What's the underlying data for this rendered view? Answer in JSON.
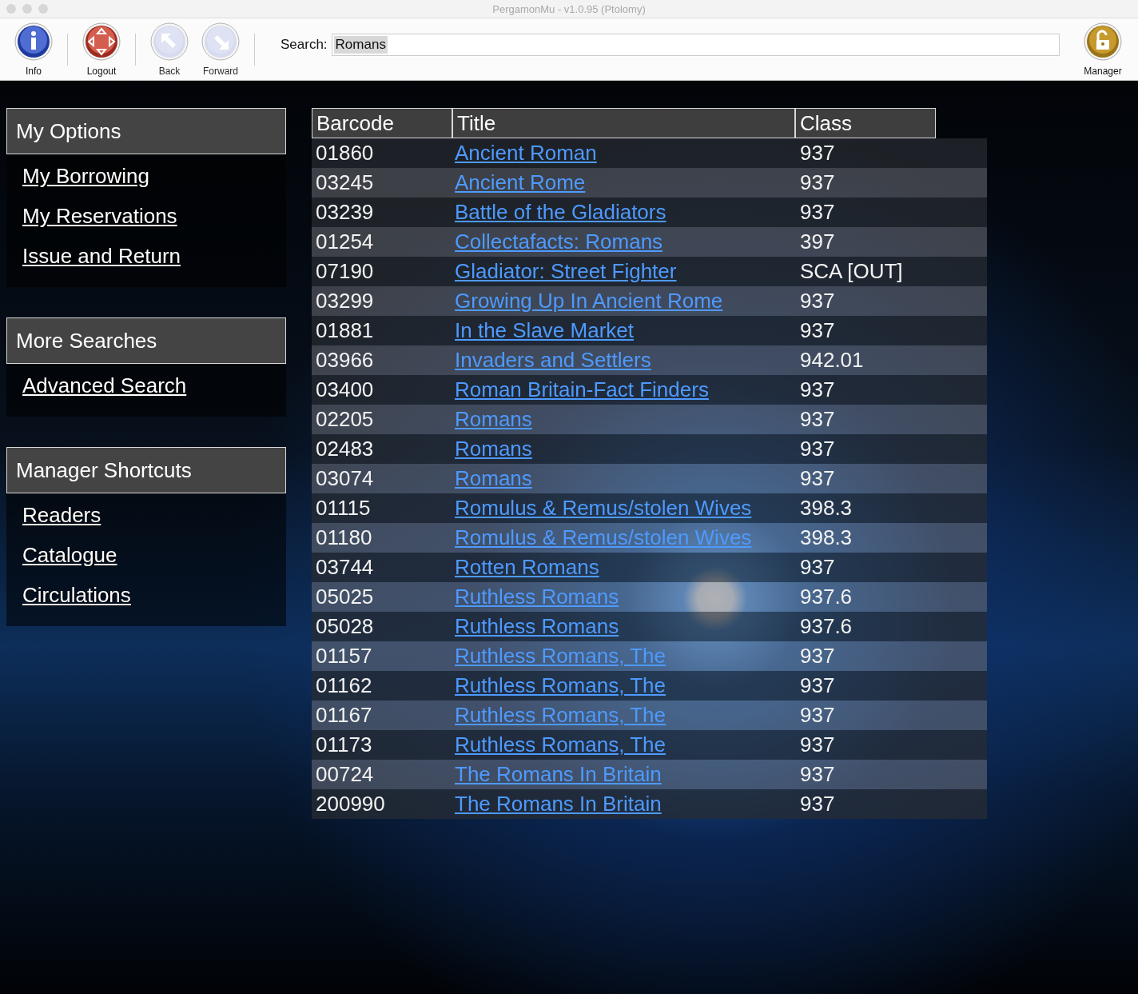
{
  "window": {
    "title": "PergamonMu - v1.0.95 (Ptolomy)"
  },
  "toolbar": [
    {
      "kind": "info",
      "label": "Info",
      "disabled": false
    },
    {
      "kind": "logout",
      "label": "Logout",
      "disabled": false
    },
    {
      "kind": "back",
      "label": "Back",
      "disabled": true
    },
    {
      "kind": "forward",
      "label": "Forward",
      "disabled": true
    }
  ],
  "search": {
    "label": "Search:",
    "value": "Romans"
  },
  "manager_button": {
    "label": "Manager"
  },
  "sidebar": [
    {
      "heading": "My Options",
      "items": [
        "My Borrowing",
        "My Reservations",
        "Issue and Return"
      ]
    },
    {
      "heading": "More Searches",
      "items": [
        "Advanced Search"
      ]
    },
    {
      "heading": "Manager Shortcuts",
      "items": [
        "Readers",
        "Catalogue",
        "Circulations"
      ]
    }
  ],
  "table": {
    "columns": [
      "Barcode",
      "Title",
      "Class"
    ],
    "rows": [
      [
        "01860",
        "Ancient Roman",
        "937"
      ],
      [
        "03245",
        "Ancient Rome",
        "937"
      ],
      [
        "03239",
        "Battle of the Gladiators",
        "937"
      ],
      [
        "01254",
        "Collectafacts: Romans",
        "397"
      ],
      [
        "07190",
        "Gladiator: Street Fighter",
        "SCA  [OUT]"
      ],
      [
        "03299",
        "Growing Up In Ancient Rome",
        "937"
      ],
      [
        "01881",
        "In the Slave Market",
        "937"
      ],
      [
        "03966",
        "Invaders and Settlers",
        "942.01"
      ],
      [
        "03400",
        "Roman Britain-Fact Finders",
        "937"
      ],
      [
        "02205",
        "Romans",
        "937"
      ],
      [
        "02483",
        "Romans",
        "937"
      ],
      [
        "03074",
        "Romans",
        "937"
      ],
      [
        "01115",
        "Romulus & Remus/stolen Wives",
        "398.3"
      ],
      [
        "01180",
        "Romulus & Remus/stolen Wives",
        "398.3"
      ],
      [
        "03744",
        "Rotten Romans",
        "937"
      ],
      [
        "05025",
        "Ruthless Romans",
        "937.6"
      ],
      [
        "05028",
        "Ruthless Romans",
        "937.6"
      ],
      [
        "01157",
        "Ruthless Romans, The",
        "937"
      ],
      [
        "01162",
        "Ruthless Romans, The",
        "937"
      ],
      [
        "01167",
        "Ruthless Romans, The",
        "937"
      ],
      [
        "01173",
        "Ruthless Romans, The",
        "937"
      ],
      [
        "00724",
        "The Romans In Britain",
        "937"
      ],
      [
        "200990",
        "The Romans In Britain",
        "937"
      ]
    ]
  }
}
